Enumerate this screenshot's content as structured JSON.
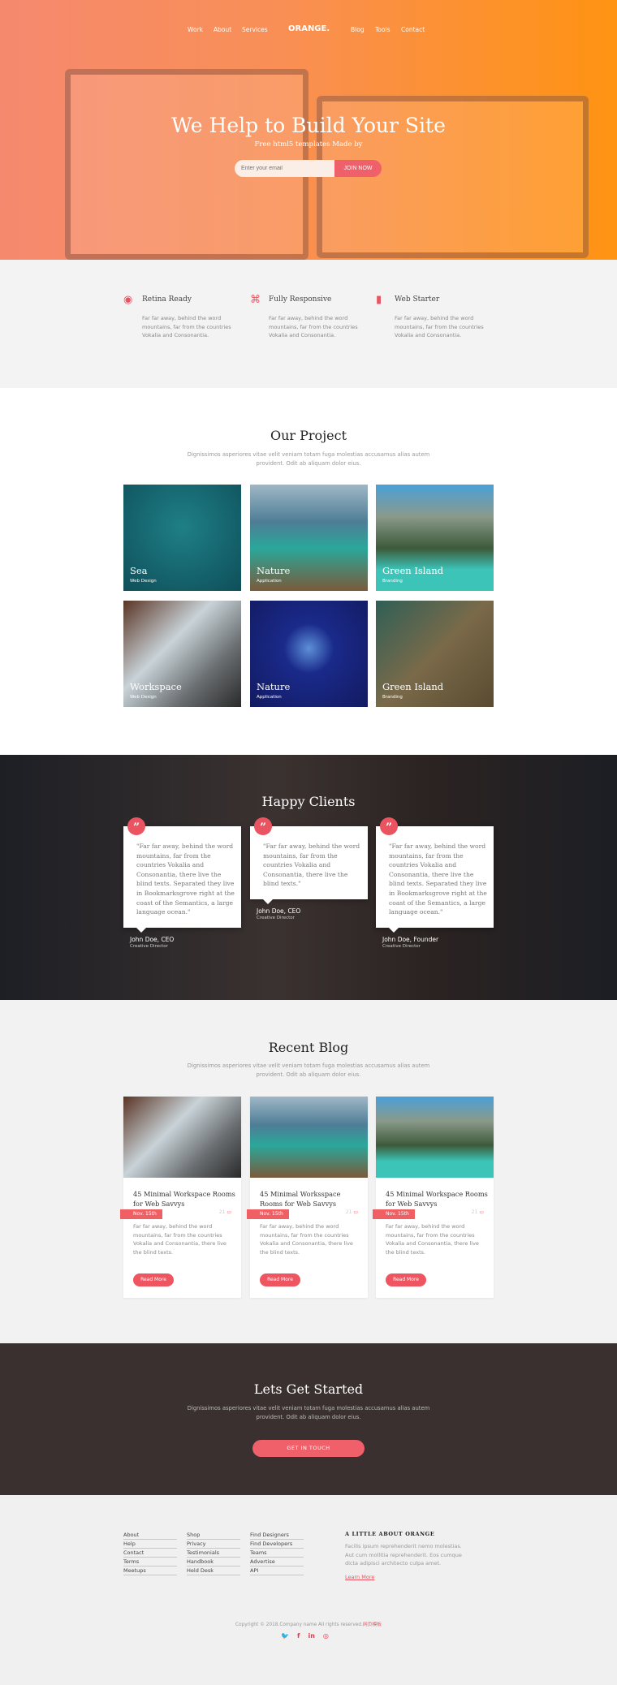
{
  "colors": {
    "accent": "#ef5f64",
    "hero_start": "#f5896f",
    "hero_end": "#ff9312",
    "dark": "#3b3030"
  },
  "nav": {
    "left": [
      "Work",
      "About",
      "Services"
    ],
    "logo": "ORANGE.",
    "right": [
      "Blog",
      "Tools",
      "Contact"
    ]
  },
  "hero": {
    "title": "We Help to Build Your Site",
    "subtitle": "Free html5 templates Made by",
    "email_placeholder": "Enter your email",
    "join_label": "JOIN NOW"
  },
  "features": [
    {
      "icon": "eye-icon",
      "title": "Retina Ready",
      "text": "Far far away, behind the word mountains, far from the countries Vokalia and Consonantia."
    },
    {
      "icon": "command-icon",
      "title": "Fully Responsive",
      "text": "Far far away, behind the word mountains, far from the countries Vokalia and Consonantia."
    },
    {
      "icon": "mouse-icon",
      "title": "Web Starter",
      "text": "Far far away, behind the word mountains, far from the countries Vokalia and Consonantia."
    }
  ],
  "projects": {
    "title": "Our Project",
    "desc": "Dignissimos asperiores vitae velit veniam totam fuga molestias accusamus alias autem provident. Odit ab aliquam dolor eius.",
    "items": [
      {
        "title": "Sea",
        "sub": "Web Design"
      },
      {
        "title": "Nature",
        "sub": "Application"
      },
      {
        "title": "Green Island",
        "sub": "Branding"
      },
      {
        "title": "Workspace",
        "sub": "Web Design"
      },
      {
        "title": "Nature",
        "sub": "Application"
      },
      {
        "title": "Green Island",
        "sub": "Branding"
      }
    ]
  },
  "clients": {
    "title": "Happy Clients",
    "items": [
      {
        "quote": "\"Far far away, behind the word mountains, far from the countries Vokalia and Consonantia, there live the blind texts. Separated they live in Bookmarksgrove right at the coast of the Semantics, a large language ocean.\"",
        "name": "John Doe, CEO",
        "role": "Creative Director"
      },
      {
        "quote": "\"Far far away, behind the word mountains, far from the countries Vokalia and Consonantia, there live the blind texts.\"",
        "name": "John Doe, CEO",
        "role": "Creative Director"
      },
      {
        "quote": "\"Far far away, behind the word mountains, far from the countries Vokalia and Consonantia, there live the blind texts. Separated they live in Bookmarksgrove right at the coast of the Semantics, a large language ocean.\"",
        "name": "John Doe, Founder",
        "role": "Creative Director"
      }
    ]
  },
  "blog": {
    "title": "Recent Blog",
    "desc": "Dignissimos asperiores vitae velit veniam totam fuga molestias accusamus alias autem provident. Odit ab aliquam dolor eius.",
    "posts": [
      {
        "title": "45 Minimal Workspace Rooms for Web Savvys",
        "date": "Nov. 15th",
        "comments": "21",
        "text": "Far far away, behind the word mountains, far from the countries Vokalia and Consonantia, there live the blind texts.",
        "button": "Read More"
      },
      {
        "title": "45 Minimal Worksspace Rooms for Web Savvys",
        "date": "Nov. 15th",
        "comments": "21",
        "text": "Far far away, behind the word mountains, far from the countries Vokalia and Consonantia, there live the blind texts.",
        "button": "Read More"
      },
      {
        "title": "45 Minimal Workspace Rooms for Web Savvys",
        "date": "Nov. 15th",
        "comments": "21",
        "text": "Far far away, behind the word mountains, far from the countries Vokalia and Consonantia, there live the blind texts.",
        "button": "Read More"
      }
    ]
  },
  "cta": {
    "title": "Lets Get Started",
    "desc": "Dignissimos asperiores vitae velit veniam totam fuga molestias accusamus alias autem provident. Odit ab aliquam dolor eius.",
    "button": "GET IN TOUCH"
  },
  "footer": {
    "columns": [
      [
        "About",
        "Help",
        "Contact",
        "Terms",
        "Meetups"
      ],
      [
        "Shop",
        "Privacy",
        "Testimonials",
        "Handbook",
        "Held Desk"
      ],
      [
        "Find Designers",
        "Find Developers",
        "Teams",
        "Advertise",
        "API"
      ]
    ],
    "about_title": "A LITTLE ABOUT ORANGE",
    "about_text": "Facilis ipsum reprehenderit nemo molestias. Aut cum mollitia reprehenderit. Eos cumque dicta adipisci architecto culpa amet.",
    "learn_more": "Learn More",
    "copyright": "Copyright © 2018.Company name All rights reserved.",
    "copyright_link": "网页模板",
    "social": [
      {
        "icon": "twitter-icon",
        "glyph": "🐦"
      },
      {
        "icon": "facebook-icon",
        "glyph": "f"
      },
      {
        "icon": "linkedin-icon",
        "glyph": "in"
      },
      {
        "icon": "dribbble-icon",
        "glyph": "◎"
      }
    ]
  }
}
